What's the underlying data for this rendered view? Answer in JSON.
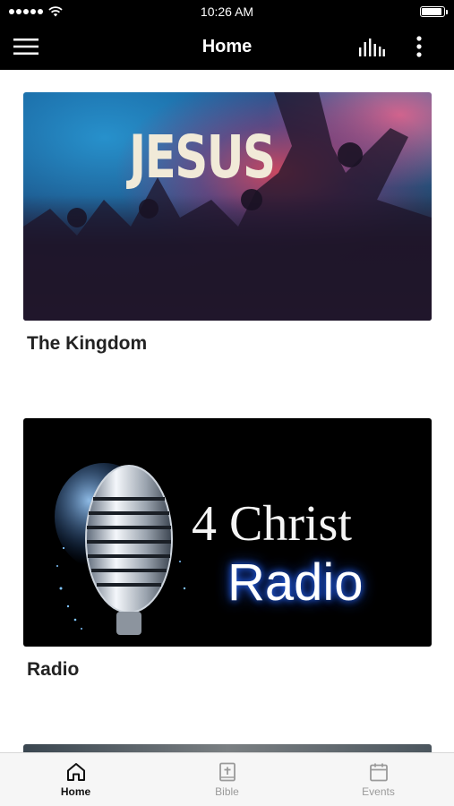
{
  "status_bar": {
    "time": "10:26 AM",
    "battery_level": 0.95
  },
  "nav": {
    "title": "Home"
  },
  "cards": [
    {
      "image_text": "JESUS",
      "title": "The Kingdom"
    },
    {
      "image_text_top": "4 Christ",
      "image_text_bottom": "Radio",
      "title": "Radio"
    }
  ],
  "tabs": [
    {
      "label": "Home",
      "icon": "home-icon",
      "active": true
    },
    {
      "label": "Bible",
      "icon": "bible-icon",
      "active": false
    },
    {
      "label": "Events",
      "icon": "calendar-icon",
      "active": false
    }
  ],
  "colors": {
    "bar_background": "#000000",
    "tab_active": "#111111",
    "tab_inactive": "#9a9a9a"
  }
}
